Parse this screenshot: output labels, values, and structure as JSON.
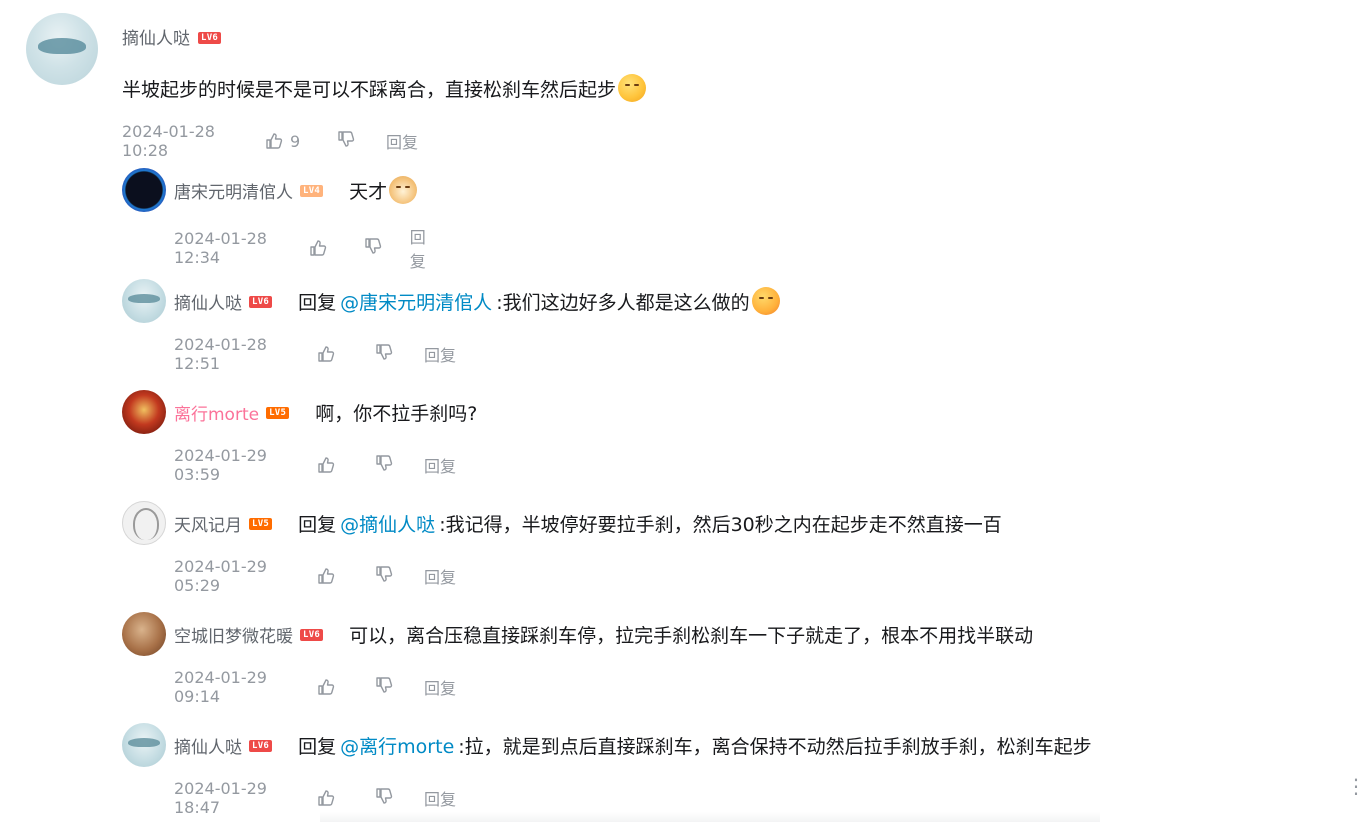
{
  "root": {
    "user": "摘仙人哒",
    "level": "LV6",
    "text": "半坡起步的时候是不是可以不踩离合，直接松刹车然后起步",
    "emoji": "grinning-emoji",
    "time": "2024-01-28 10:28",
    "likes": "9",
    "reply_label": "回复"
  },
  "replies": [
    {
      "user": "唐宋元明清倌人",
      "level": "LV4",
      "prefix": "",
      "at": "",
      "text": "天才",
      "emoji": "doge-emoji",
      "time": "2024-01-28 12:34",
      "reply_label": "回复"
    },
    {
      "user": "摘仙人哒",
      "level": "LV6",
      "prefix": "回复",
      "at": "@唐宋元明清倌人",
      "text": ":我们这边好多人都是这么做的",
      "emoji": "blush-emoji",
      "time": "2024-01-28 12:51",
      "reply_label": "回复"
    },
    {
      "user": "离行morte",
      "level": "LV5",
      "prefix": "",
      "at": "",
      "text": "啊，你不拉手刹吗?",
      "time": "2024-01-29 03:59",
      "reply_label": "回复"
    },
    {
      "user": "天风记月",
      "level": "LV5",
      "prefix": "回复",
      "at": "@摘仙人哒",
      "text": ":我记得，半坡停好要拉手刹，然后30秒之内在起步走不然直接一百",
      "time": "2024-01-29 05:29",
      "reply_label": "回复"
    },
    {
      "user": "空城旧梦微花暖",
      "level": "LV6",
      "prefix": "",
      "at": "",
      "text": "可以，离合压稳直接踩刹车停，拉完手刹松刹车一下子就走了，根本不用找半联动",
      "time": "2024-01-29 09:14",
      "reply_label": "回复"
    },
    {
      "user": "摘仙人哒",
      "level": "LV6",
      "prefix": "回复",
      "at": "@离行morte",
      "text": ":拉，就是到点后直接踩刹车，离合保持不动然后拉手刹放手刹，松刹车起步",
      "time": "2024-01-29 18:47",
      "reply_label": "回复"
    }
  ],
  "menu_icon": "more-vertical-icon"
}
